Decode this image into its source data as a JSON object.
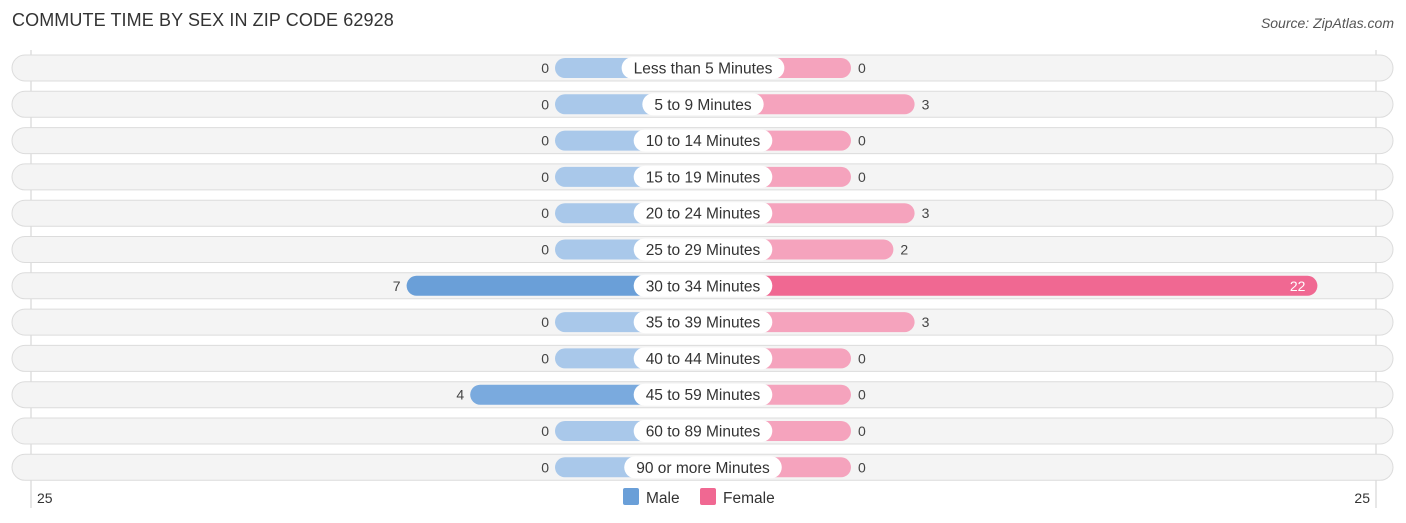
{
  "header": {
    "title": "COMMUTE TIME BY SEX IN ZIP CODE 62928",
    "source": "Source: ZipAtlas.com"
  },
  "colors": {
    "male": "#6a9fd8",
    "male_light": "#a9c8ea",
    "female": "#f06892",
    "female_light": "#f5a3bd",
    "row_bg": "#f4f4f4"
  },
  "chart_data": {
    "type": "bar",
    "orientation": "horizontal-diverging",
    "title": "COMMUTE TIME BY SEX IN ZIP CODE 62928",
    "categories": [
      "Less than 5 Minutes",
      "5 to 9 Minutes",
      "10 to 14 Minutes",
      "15 to 19 Minutes",
      "20 to 24 Minutes",
      "25 to 29 Minutes",
      "30 to 34 Minutes",
      "35 to 39 Minutes",
      "40 to 44 Minutes",
      "45 to 59 Minutes",
      "60 to 89 Minutes",
      "90 or more Minutes"
    ],
    "series": [
      {
        "name": "Male",
        "values": [
          0,
          0,
          0,
          0,
          0,
          0,
          7,
          0,
          0,
          4,
          0,
          0
        ]
      },
      {
        "name": "Female",
        "values": [
          0,
          3,
          0,
          0,
          3,
          2,
          22,
          3,
          0,
          0,
          0,
          0
        ]
      }
    ],
    "axis": {
      "left_label": "25",
      "right_label": "25",
      "max": 25
    },
    "legend": {
      "position": "bottom-center",
      "items": [
        "Male",
        "Female"
      ]
    }
  }
}
